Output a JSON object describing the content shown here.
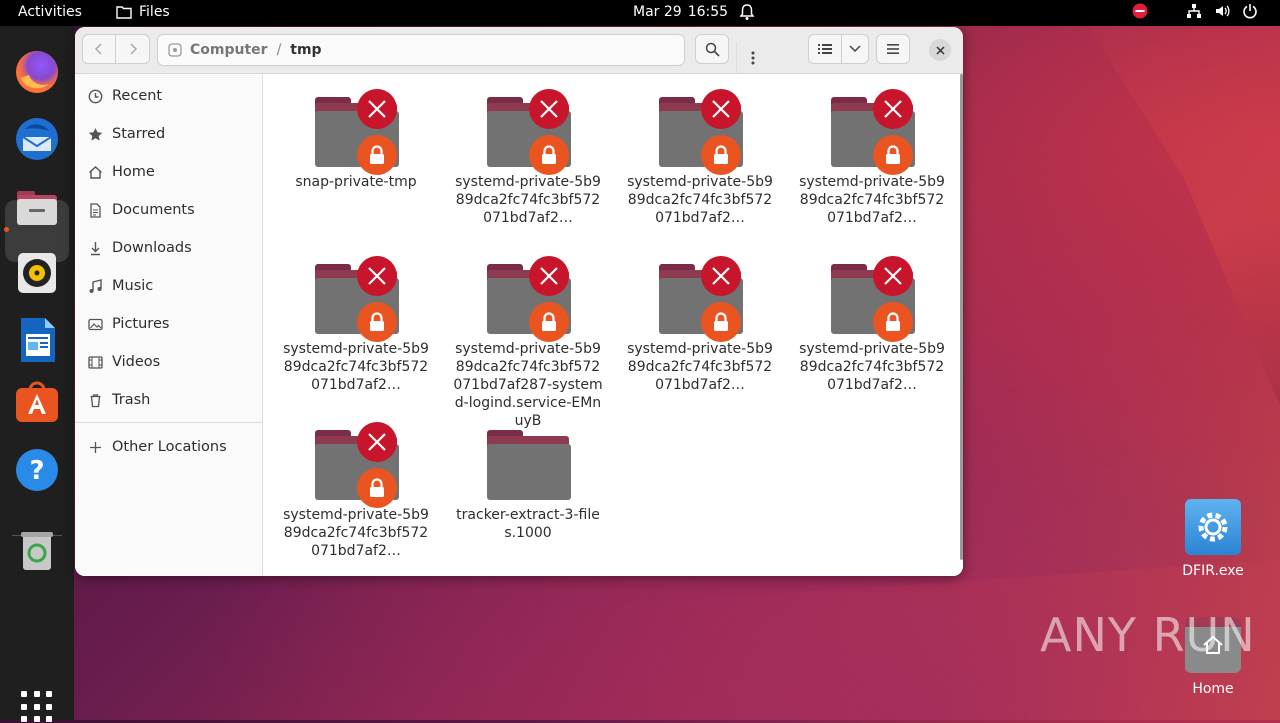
{
  "topbar": {
    "activities": "Activities",
    "app_name": "Files",
    "date": "Mar 29",
    "time": "16:55"
  },
  "window": {
    "path": {
      "root": "Computer",
      "separator": "/",
      "current": "tmp"
    }
  },
  "sidebar": {
    "items": [
      {
        "label": "Recent",
        "icon": "clock-icon"
      },
      {
        "label": "Starred",
        "icon": "star-icon"
      },
      {
        "label": "Home",
        "icon": "home-icon"
      },
      {
        "label": "Documents",
        "icon": "document-icon"
      },
      {
        "label": "Downloads",
        "icon": "download-icon"
      },
      {
        "label": "Music",
        "icon": "music-icon"
      },
      {
        "label": "Pictures",
        "icon": "picture-icon"
      },
      {
        "label": "Videos",
        "icon": "video-icon"
      },
      {
        "label": "Trash",
        "icon": "trash-icon"
      }
    ],
    "other_locations": "Other Locations"
  },
  "files": [
    {
      "name": "snap-private-tmp",
      "locked": true
    },
    {
      "name": "systemd-private-5b989dca2fc74fc3bf572071bd7af2…",
      "locked": true
    },
    {
      "name": "systemd-private-5b989dca2fc74fc3bf572071bd7af2…",
      "locked": true
    },
    {
      "name": "systemd-private-5b989dca2fc74fc3bf572071bd7af2…",
      "locked": true
    },
    {
      "name": "systemd-private-5b989dca2fc74fc3bf572071bd7af2…",
      "locked": true
    },
    {
      "name": "systemd-private-5b989dca2fc74fc3bf572071bd7af287-systemd-logind.service-EMnuyB",
      "locked": true
    },
    {
      "name": "systemd-private-5b989dca2fc74fc3bf572071bd7af2…",
      "locked": true
    },
    {
      "name": "systemd-private-5b989dca2fc74fc3bf572071bd7af2…",
      "locked": true
    },
    {
      "name": "systemd-private-5b989dca2fc74fc3bf572071bd7af2…",
      "locked": true
    },
    {
      "name": "tracker-extract-3-files.1000",
      "locked": false
    }
  ],
  "desktop": {
    "icons": [
      {
        "label": "DFIR.exe",
        "icon": "gear-file-icon"
      },
      {
        "label": "Home",
        "icon": "home-folder-icon"
      }
    ],
    "watermark": "ANY RUN"
  },
  "colors": {
    "accent": "#e95420",
    "error": "#c7162b",
    "folder_gray": "#727272",
    "folder_top": "#8e3a50"
  }
}
